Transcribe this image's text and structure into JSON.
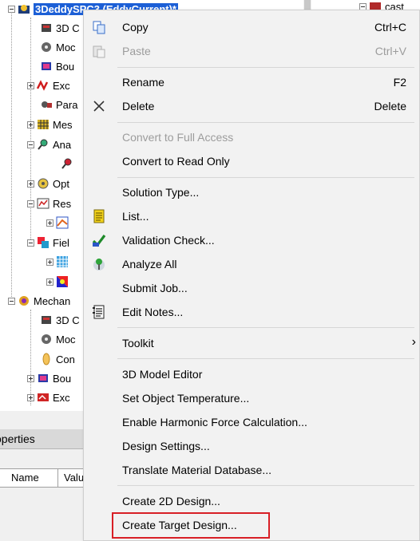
{
  "tree": {
    "root_label": "3DeddySPC3 (EddyCurrent)*",
    "items": [
      {
        "label": "3D C"
      },
      {
        "label": "Moc"
      },
      {
        "label": "Bou"
      },
      {
        "label": "Exc"
      },
      {
        "label": "Para"
      },
      {
        "label": "Mes"
      },
      {
        "label": "Ana"
      },
      {
        "label": ""
      },
      {
        "label": "Opt"
      },
      {
        "label": "Res"
      },
      {
        "label": ""
      },
      {
        "label": "Fiel"
      },
      {
        "label": ""
      },
      {
        "label": ""
      },
      {
        "label": "Mechan"
      },
      {
        "label": "3D C"
      },
      {
        "label": "Moc"
      },
      {
        "label": "Con"
      },
      {
        "label": "Bou"
      },
      {
        "label": "Exc"
      }
    ],
    "right_item": "cast"
  },
  "properties": {
    "title": "operties",
    "col_name": "Name",
    "col_value": "Valu"
  },
  "menu": {
    "items": [
      {
        "label": "Copy",
        "shortcut": "Ctrl+C",
        "icon": "copy-icon"
      },
      {
        "label": "Paste",
        "shortcut": "Ctrl+V",
        "icon": "paste-icon"
      },
      {
        "label": "Rename",
        "shortcut": "F2"
      },
      {
        "label": "Delete",
        "shortcut": "Delete",
        "icon": "delete-x-icon"
      },
      {
        "label": "Convert to Full Access"
      },
      {
        "label": "Convert to Read Only"
      },
      {
        "label": "Solution Type..."
      },
      {
        "label": "List...",
        "icon": "list-icon"
      },
      {
        "label": "Validation Check...",
        "icon": "validation-check-icon"
      },
      {
        "label": "Analyze All",
        "icon": "analyze-all-icon"
      },
      {
        "label": "Submit Job..."
      },
      {
        "label": "Edit Notes...",
        "icon": "notes-icon"
      },
      {
        "label": "Toolkit",
        "submenu_glyph": "›"
      },
      {
        "label": "3D Model Editor"
      },
      {
        "label": "Set Object Temperature..."
      },
      {
        "label": "Enable Harmonic Force Calculation..."
      },
      {
        "label": "Design Settings..."
      },
      {
        "label": "Translate Material Database..."
      },
      {
        "label": "Create 2D Design..."
      },
      {
        "label": "Create Target Design..."
      }
    ],
    "disabled": [
      "Paste",
      "Convert to Full Access"
    ],
    "highlighted_item": "Create Target Design...",
    "highlight_color": "#d81f26"
  },
  "colors": {
    "selection": "#1c5fd6",
    "menu_background": "#f2f2f2"
  }
}
